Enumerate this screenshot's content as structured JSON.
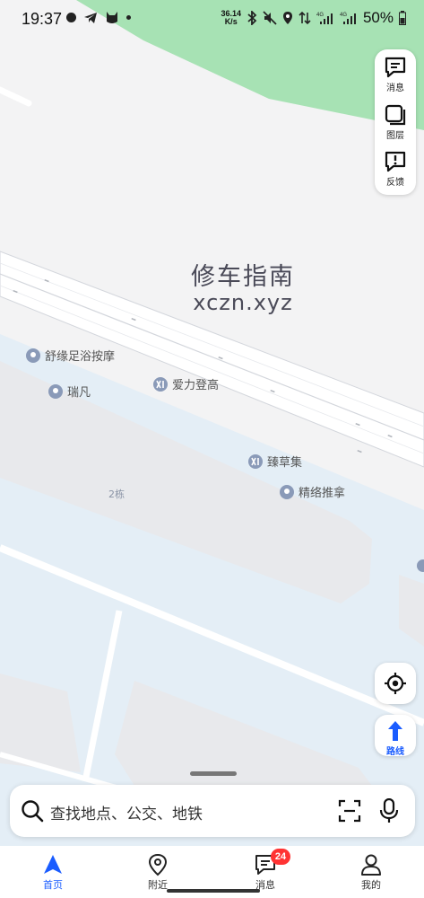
{
  "status_bar": {
    "time": "19:37",
    "net_speed_value": "36.14",
    "net_speed_unit": "K/s",
    "battery": "50%"
  },
  "side_toolbar": {
    "messages_label": "消息",
    "layers_label": "图层",
    "feedback_label": "反馈"
  },
  "watermark": {
    "line1": "修车指南",
    "line2": "xczn.xyz"
  },
  "map": {
    "pois": [
      {
        "name": "舒缘足浴按摩",
        "icon": "location-pin-icon"
      },
      {
        "name": "瑞凡",
        "icon": "location-pin-icon"
      },
      {
        "name": "爱力登高",
        "icon": "brand-xi-icon"
      },
      {
        "name": "臻草集",
        "icon": "brand-xi-icon"
      },
      {
        "name": "精络推拿",
        "icon": "location-pin-icon"
      }
    ],
    "building_label": "2栋"
  },
  "controls": {
    "route_label": "路线"
  },
  "search": {
    "placeholder": "查找地点、公交、地铁"
  },
  "bottom_nav": {
    "items": [
      {
        "label": "首页",
        "icon": "navigation-arrow-icon",
        "active": true
      },
      {
        "label": "附近",
        "icon": "location-pin-icon",
        "active": false
      },
      {
        "label": "消息",
        "icon": "message-icon",
        "active": false,
        "badge": "24"
      },
      {
        "label": "我的",
        "icon": "person-icon",
        "active": false
      }
    ]
  },
  "colors": {
    "accent": "#1a5cff",
    "park_green": "#a7e2b4",
    "water_blue": "#e4eef6",
    "badge_red": "#ff3333"
  }
}
